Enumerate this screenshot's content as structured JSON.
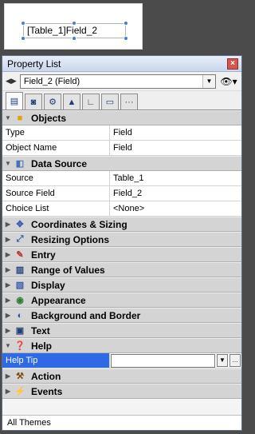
{
  "canvas": {
    "field_text": "[Table_1]Field_2"
  },
  "panel": {
    "title": "Property List",
    "object_select": "Field_2 (Field)",
    "footer": "All Themes"
  },
  "groups": [
    {
      "label": "Objects",
      "icon": "cube-icon",
      "expanded": true,
      "rows": [
        {
          "name": "Type",
          "value": "Field"
        },
        {
          "name": "Object Name",
          "value": "Field"
        }
      ]
    },
    {
      "label": "Data Source",
      "icon": "data-source-icon",
      "expanded": true,
      "rows": [
        {
          "name": "Source",
          "value": "Table_1"
        },
        {
          "name": "Source Field",
          "value": "Field_2"
        },
        {
          "name": "Choice List",
          "value": "<None>"
        }
      ]
    },
    {
      "label": "Coordinates & Sizing",
      "icon": "move-icon",
      "expanded": false
    },
    {
      "label": "Resizing Options",
      "icon": "resize-icon",
      "expanded": false
    },
    {
      "label": "Entry",
      "icon": "entry-icon",
      "expanded": false
    },
    {
      "label": "Range of Values",
      "icon": "book-icon",
      "expanded": false
    },
    {
      "label": "Display",
      "icon": "display-icon",
      "expanded": false
    },
    {
      "label": "Appearance",
      "icon": "eye-icon",
      "expanded": false
    },
    {
      "label": "Background and Border",
      "icon": "paint-icon",
      "expanded": false
    },
    {
      "label": "Text",
      "icon": "text-icon",
      "expanded": false
    },
    {
      "label": "Help",
      "icon": "help-icon",
      "expanded": true,
      "rows": [
        {
          "name": "Help Tip",
          "value": ""
        }
      ]
    },
    {
      "label": "Action",
      "icon": "action-icon",
      "expanded": false
    },
    {
      "label": "Events",
      "icon": "events-icon",
      "expanded": false
    }
  ],
  "colors": {
    "selected": "#2f6ae6",
    "section_bg": "#d4d4d4"
  }
}
